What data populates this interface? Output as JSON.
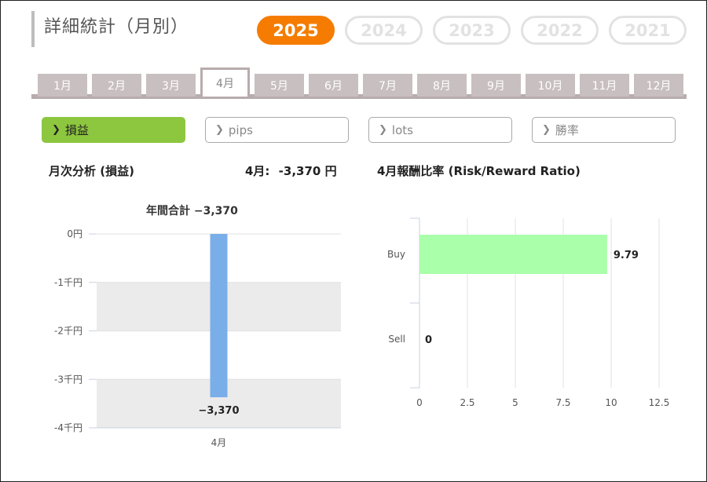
{
  "page": {
    "title": "詳細統計（月別）",
    "years": [
      "2025",
      "2024",
      "2023",
      "2022",
      "2021"
    ],
    "active_year": "2025",
    "months": [
      "1月",
      "2月",
      "3月",
      "4月",
      "5月",
      "6月",
      "7月",
      "8月",
      "9月",
      "10月",
      "11月",
      "12月"
    ],
    "active_month": "4月",
    "metrics": [
      "損益",
      "pips",
      "lots",
      "勝率"
    ],
    "active_metric": "損益",
    "colors": {
      "accent_orange": "#f57c00",
      "active_green": "#8dc63f",
      "bar_blue": "#7aaee8",
      "bar_green": "#aaffaa"
    }
  },
  "left": {
    "heading": "月次分析 (損益)",
    "month_value_label": "4月:",
    "month_value": "-3,370 円"
  },
  "right": {
    "heading": "4月報酬比率 (Risk/Reward Ratio)"
  },
  "chart_data": [
    {
      "type": "bar",
      "title": "年間合計 −3,370",
      "categories": [
        "4月"
      ],
      "values": [
        -3370
      ],
      "data_labels": [
        "−3,370"
      ],
      "y_ticks": [
        "0円",
        "-1千円",
        "-2千円",
        "-3千円",
        "-4千円"
      ],
      "ylim": [
        -4000,
        0
      ]
    },
    {
      "type": "bar",
      "orientation": "horizontal",
      "categories": [
        "Buy",
        "Sell"
      ],
      "values": [
        9.79,
        0
      ],
      "data_labels": [
        "9.79",
        "0"
      ],
      "x_ticks": [
        "0",
        "2.5",
        "5",
        "7.5",
        "10",
        "12.5"
      ],
      "xlim": [
        0,
        12.5
      ]
    }
  ]
}
